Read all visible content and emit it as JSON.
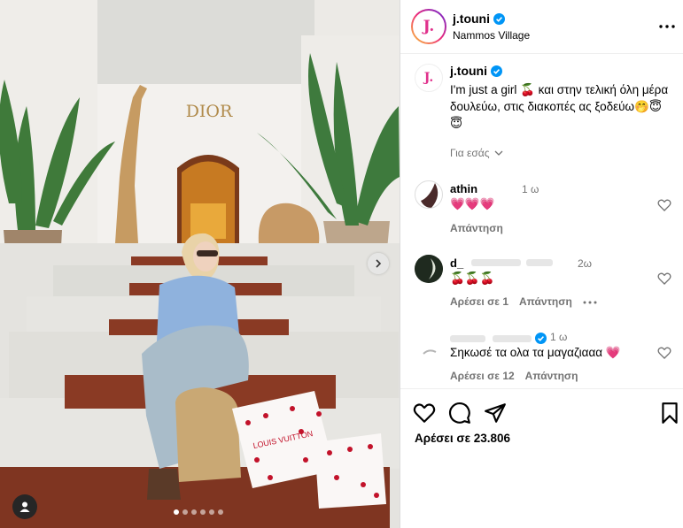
{
  "photo": {
    "storefront_sign": "DIOR",
    "bag_print": "LOUIS VUITTON",
    "carousel_count": 6,
    "carousel_active": 1,
    "colors": {
      "stair": "#8a3a24",
      "wall": "#f3f1ee",
      "sky": "#eceae6",
      "jacket": "#8fb2dd",
      "jeans": "#a9bcc9",
      "bag": "#c9a874",
      "cherry": "#c2122a"
    }
  },
  "header": {
    "avatar_letter": "J.",
    "username": "j.touni",
    "location": "Nammos Village",
    "more_icon": "more-horizontal-icon"
  },
  "caption": {
    "avatar_letter": "J.",
    "username": "j.touni",
    "text": "I'm just a girl 🍒  και στην τελική όλη μέρα δουλεύω, στις διακοπές ας ξοδεύω🤭😇😇",
    "for_you": "Για εσάς"
  },
  "comments": [
    {
      "username": "athin",
      "time": "1 ω",
      "text": "💗💗💗",
      "reply": "Απάντηση",
      "likes": ""
    },
    {
      "username": "d_",
      "time": "2ω",
      "text": "🍒🍒🍒",
      "likes": "Αρέσει σε 1",
      "reply": "Απάντηση"
    },
    {
      "username": "",
      "time": "1 ω",
      "text": "Σηκωσέ τα ολα τα μαγαζιααα 💗",
      "likes": "Αρέσει σε 12",
      "reply": "Απάντηση"
    }
  ],
  "footer": {
    "likes_text": "Αρέσει σε 23.806",
    "icons": [
      "heart-icon",
      "comment-icon",
      "share-icon",
      "bookmark-icon"
    ]
  },
  "accent": "#0095f6"
}
